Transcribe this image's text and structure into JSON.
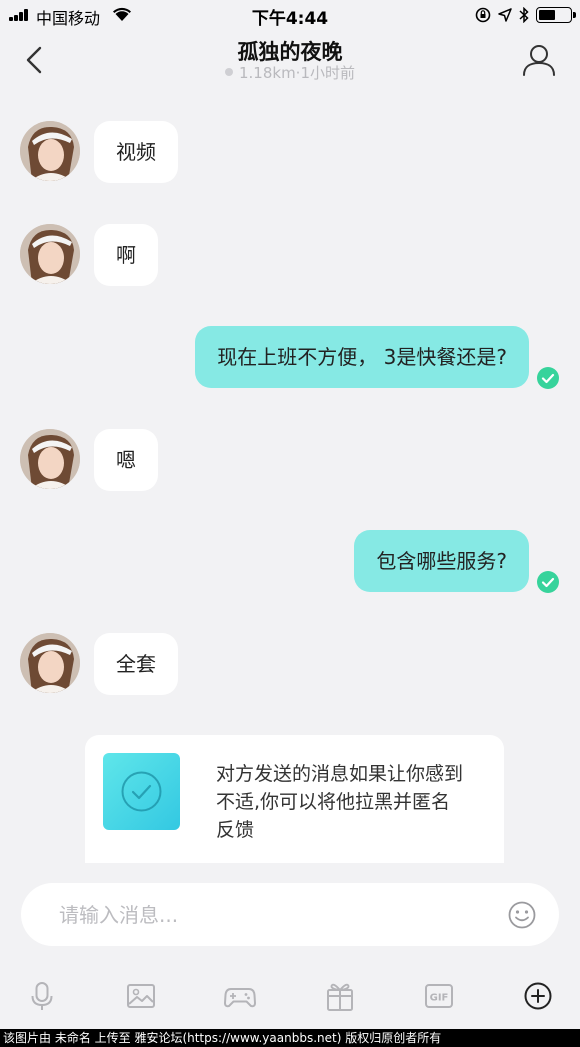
{
  "status_bar": {
    "carrier": "中国移动",
    "time": "下午4:44",
    "battery_level": 0.55
  },
  "header": {
    "title": "孤独的夜晚",
    "subtitle": "1.18km·1小时前"
  },
  "messages": [
    {
      "direction": "incoming",
      "text": "视频"
    },
    {
      "direction": "incoming",
      "text": "啊"
    },
    {
      "direction": "outgoing",
      "text": "现在上班不方便，  3是快餐还是?",
      "read": true
    },
    {
      "direction": "incoming",
      "text": "嗯"
    },
    {
      "direction": "outgoing",
      "text": "包含哪些服务?",
      "read": true
    },
    {
      "direction": "incoming",
      "text": "全套"
    }
  ],
  "safety_notice": {
    "text": "对方发送的消息如果让你感到不适,你可以将他拉黑并匿名反馈"
  },
  "input": {
    "placeholder": "请输入消息..."
  },
  "toolbar": {
    "icons": [
      "microphone-icon",
      "image-icon",
      "gamepad-icon",
      "gift-icon",
      "gif-icon",
      "plus-circle-icon"
    ]
  },
  "watermark": "该图片由 未命名 上传至 雅安论坛(https://www.yaanbbs.net) 版权归原创者所有",
  "colors": {
    "background": "#f2f2f4",
    "outgoing_bubble": "#86e9e4",
    "incoming_bubble": "#ffffff",
    "read_check": "#37d39b",
    "accent_gradient_start": "#5fe6ea",
    "accent_gradient_end": "#33c8e2"
  }
}
